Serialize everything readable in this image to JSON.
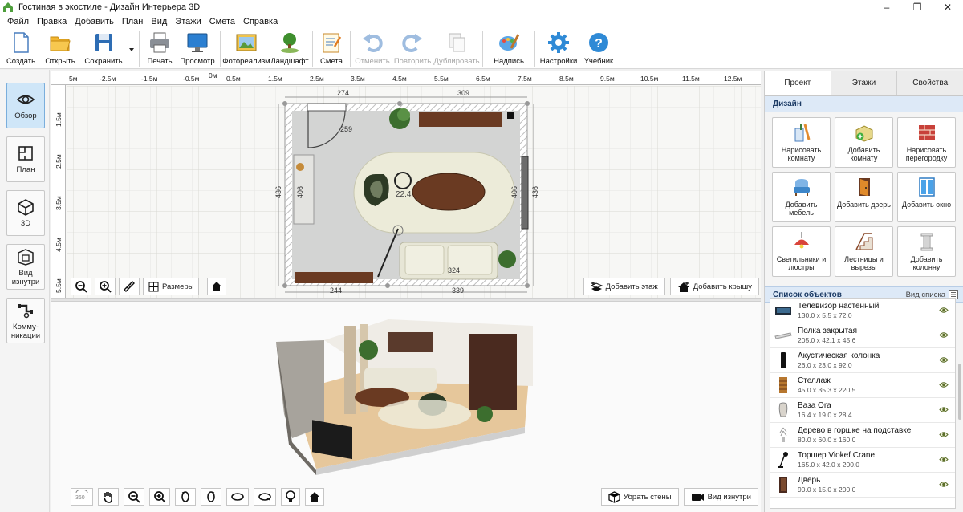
{
  "window": {
    "title": "Гостиная в экостиле - Дизайн Интерьера 3D",
    "controls": [
      "–",
      "❐",
      "✕"
    ]
  },
  "menu": [
    "Файл",
    "Правка",
    "Добавить",
    "План",
    "Вид",
    "Этажи",
    "Смета",
    "Справка"
  ],
  "toolbar": {
    "create": "Создать",
    "open": "Открыть",
    "save": "Сохранить",
    "print": "Печать",
    "preview": "Просмотр",
    "photoreal": "Фотореализм",
    "landscape": "Ландшафт",
    "estimate": "Смета",
    "undo": "Отменить",
    "redo": "Повторить",
    "duplicate": "Дублировать",
    "caption": "Надпись",
    "settings": "Настройки",
    "tutorial": "Учебник"
  },
  "sidebar": {
    "overview": "Обзор",
    "plan": "План",
    "view3d": "3D",
    "inside_view": "Вид изнутри",
    "utilities": "Комму-никации"
  },
  "plan": {
    "ruler_top": [
      "5м",
      "-2.5м",
      "-1.5м",
      "-0.5м",
      "0м",
      "0.5м",
      "1.5м",
      "2.5м",
      "3.5м",
      "4.5м",
      "5.5м",
      "6.5м",
      "7.5м",
      "8.5м",
      "9.5м",
      "10.5м",
      "11.5м",
      "12.5м"
    ],
    "ruler_left": [
      "1.5м",
      "2.5м",
      "3.5м",
      "4.5м",
      "5.5м"
    ],
    "dimensions": {
      "top_left": "274",
      "top_right": "309",
      "inner_top": "259",
      "left_outer": "436",
      "left_inner": "406",
      "right_inner": "406",
      "right_outer": "436",
      "bottom_inner": "324",
      "bottom_left": "244",
      "bottom_right": "339",
      "table_label": "22.4"
    },
    "dimensions_button": "Размеры",
    "add_floor": "Добавить этаж",
    "add_roof": "Добавить крышу"
  },
  "view3d": {
    "remove_walls": "Убрать стены",
    "inside_view": "Вид изнутри"
  },
  "right_panel": {
    "tabs": [
      "Проект",
      "Этажи",
      "Свойства"
    ],
    "design_header": "Дизайн",
    "design_buttons": [
      {
        "label": "Нарисовать комнату",
        "icon": "draw-room-icon"
      },
      {
        "label": "Добавить комнату",
        "icon": "add-room-icon"
      },
      {
        "label": "Нарисовать перегородку",
        "icon": "brick-wall-icon"
      },
      {
        "label": "Добавить мебель",
        "icon": "armchair-icon"
      },
      {
        "label": "Добавить дверь",
        "icon": "door-icon"
      },
      {
        "label": "Добавить окно",
        "icon": "window-icon"
      },
      {
        "label": "Светильники и люстры",
        "icon": "lamp-icon"
      },
      {
        "label": "Лестницы и вырезы",
        "icon": "stairs-icon"
      },
      {
        "label": "Добавить колонну",
        "icon": "column-icon"
      }
    ],
    "objects_header": "Список объектов",
    "view_list": "Вид списка",
    "objects": [
      {
        "name": "Телевизор настенный",
        "size": "130.0 x 5.5 x 72.0"
      },
      {
        "name": "Полка закрытая",
        "size": "205.0 x 42.1 x 45.6"
      },
      {
        "name": "Акустическая колонка",
        "size": "26.0 x 23.0 x 92.0"
      },
      {
        "name": "Стеллаж",
        "size": "45.0 x 35.3 x 220.5"
      },
      {
        "name": "Ваза Ora",
        "size": "16.4 x 19.0 x 28.4"
      },
      {
        "name": "Дерево в горшке на подставке",
        "size": "80.0 x 60.0 x 160.0"
      },
      {
        "name": "Торшер Viokef Crane",
        "size": "165.0 x 42.0 x 200.0"
      },
      {
        "name": "Дверь",
        "size": "90.0 x 15.0 x 200.0"
      }
    ]
  },
  "colors": {
    "accent": "#2a78c4",
    "active_side": "#cfe6f8",
    "header_blue": "#dde9f7",
    "floor": "#d3d4d3",
    "rug": "#ecebd9",
    "wood_table": "#6a3a22"
  }
}
